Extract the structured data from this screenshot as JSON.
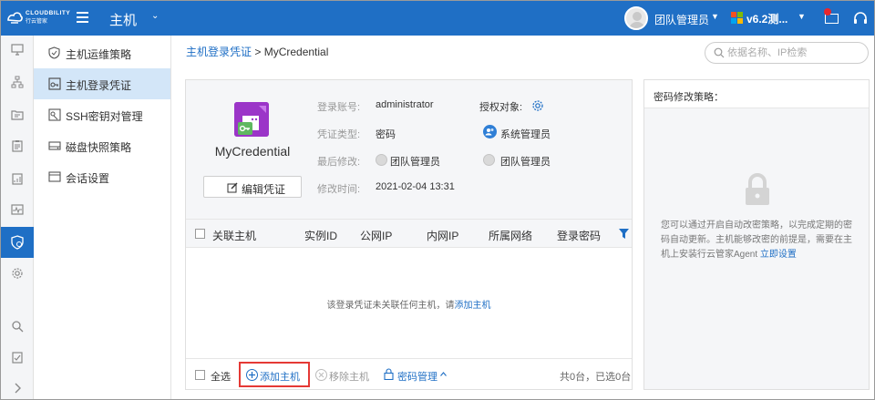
{
  "topbar": {
    "logo_text": "CLOUDBILITY",
    "logo_sub": "行云管家",
    "module": "主机",
    "user": "团队管理员",
    "version": "v6.2测..."
  },
  "subnav": {
    "items": [
      {
        "label": "主机运维策略",
        "icon": "shield-icon"
      },
      {
        "label": "主机登录凭证",
        "icon": "key-card-icon",
        "active": true
      },
      {
        "label": "SSH密钥对管理",
        "icon": "key-icon"
      },
      {
        "label": "磁盘快照策略",
        "icon": "disk-icon"
      },
      {
        "label": "会话设置",
        "icon": "window-icon"
      }
    ]
  },
  "breadcrumb": {
    "parent": "主机登录凭证",
    "separator": " > ",
    "current": "MyCredential"
  },
  "search": {
    "placeholder": "依据名称、IP检索"
  },
  "credential": {
    "name": "MyCredential",
    "edit_label": "编辑凭证",
    "account_label": "登录账号:",
    "account_value": "administrator",
    "type_label": "凭证类型:",
    "type_value": "密码",
    "modifier_label": "最后修改:",
    "modifier_value": "团队管理员",
    "time_label": "修改时间:",
    "time_value": "2021-02-04 13:31",
    "grant_label": "授权对象:",
    "grant_role": "系统管理员",
    "grant_user": "团队管理员"
  },
  "table": {
    "columns": [
      "关联主机",
      "实例ID",
      "公网IP",
      "内网IP",
      "所属网络",
      "登录密码"
    ],
    "empty_text": "该登录凭证未关联任何主机，请",
    "empty_link": "添加主机"
  },
  "footer": {
    "select_all": "全选",
    "add_host": "添加主机",
    "remove_host": "移除主机",
    "password_mgmt": "密码管理",
    "count": "共0台，已选0台"
  },
  "side_panel": {
    "title": "密码修改策略：",
    "text": "您可以通过开启自动改密策略，以完成定期的密码自动更新。主机能够改密的前提是，需要在主机上安装行云管家Agent",
    "link": "立即设置"
  },
  "colors": {
    "brand": "#1f6fc5",
    "credential_icon": "#9b35c8",
    "highlight": "#e53935"
  }
}
